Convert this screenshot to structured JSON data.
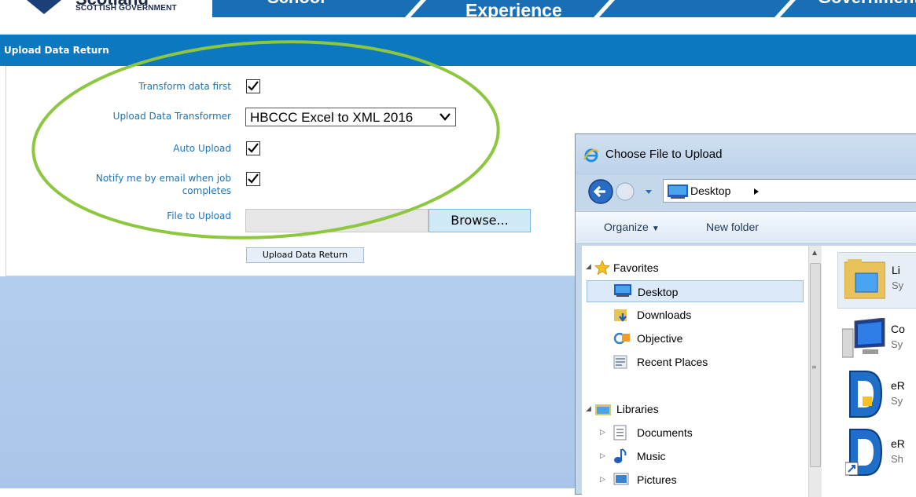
{
  "banner": {
    "brand_main": "Scotland",
    "brand_sub": "SCOTTISH GOVERNMENT",
    "nav_word_1": "School",
    "nav_word_2": "Experience",
    "nav_word_3": "Government"
  },
  "page": {
    "title": "Upload Data Return"
  },
  "form": {
    "transform_label": "Transform data first",
    "transform_checked": true,
    "transformer_label": "Upload Data Transformer",
    "transformer_value": "HBCCC Excel to XML 2016",
    "auto_upload_label": "Auto Upload",
    "auto_upload_checked": true,
    "notify_label_line1": "Notify me by email when job",
    "notify_label_line2": "completes",
    "notify_checked": true,
    "file_label": "File to Upload",
    "browse_label": "Browse...",
    "submit_label": "Upload Data Return"
  },
  "colors": {
    "title_bar": "#0b78bf",
    "label_text": "#1e73b6",
    "annotation_ellipse": "#8dc63f",
    "page_background": "#b3cdec"
  },
  "dialog": {
    "title": "Choose File to Upload",
    "address": "Desktop",
    "toolbar": {
      "organize": "Organize",
      "new_folder": "New folder"
    },
    "nav": {
      "favorites": "Favorites",
      "desktop": "Desktop",
      "downloads": "Downloads",
      "objective": "Objective",
      "recent_places": "Recent Places",
      "libraries": "Libraries",
      "documents": "Documents",
      "music": "Music",
      "pictures": "Pictures"
    },
    "content": [
      {
        "name": "Li",
        "sub": "Sy",
        "icon": "library-folder-icon"
      },
      {
        "name": "Co",
        "sub": "Sy",
        "icon": "computer-icon"
      },
      {
        "name": "eR",
        "sub": "Sy",
        "icon": "erecords-app-icon"
      },
      {
        "name": "eR",
        "sub": "Sh",
        "icon": "erecords-shortcut-icon"
      }
    ]
  }
}
